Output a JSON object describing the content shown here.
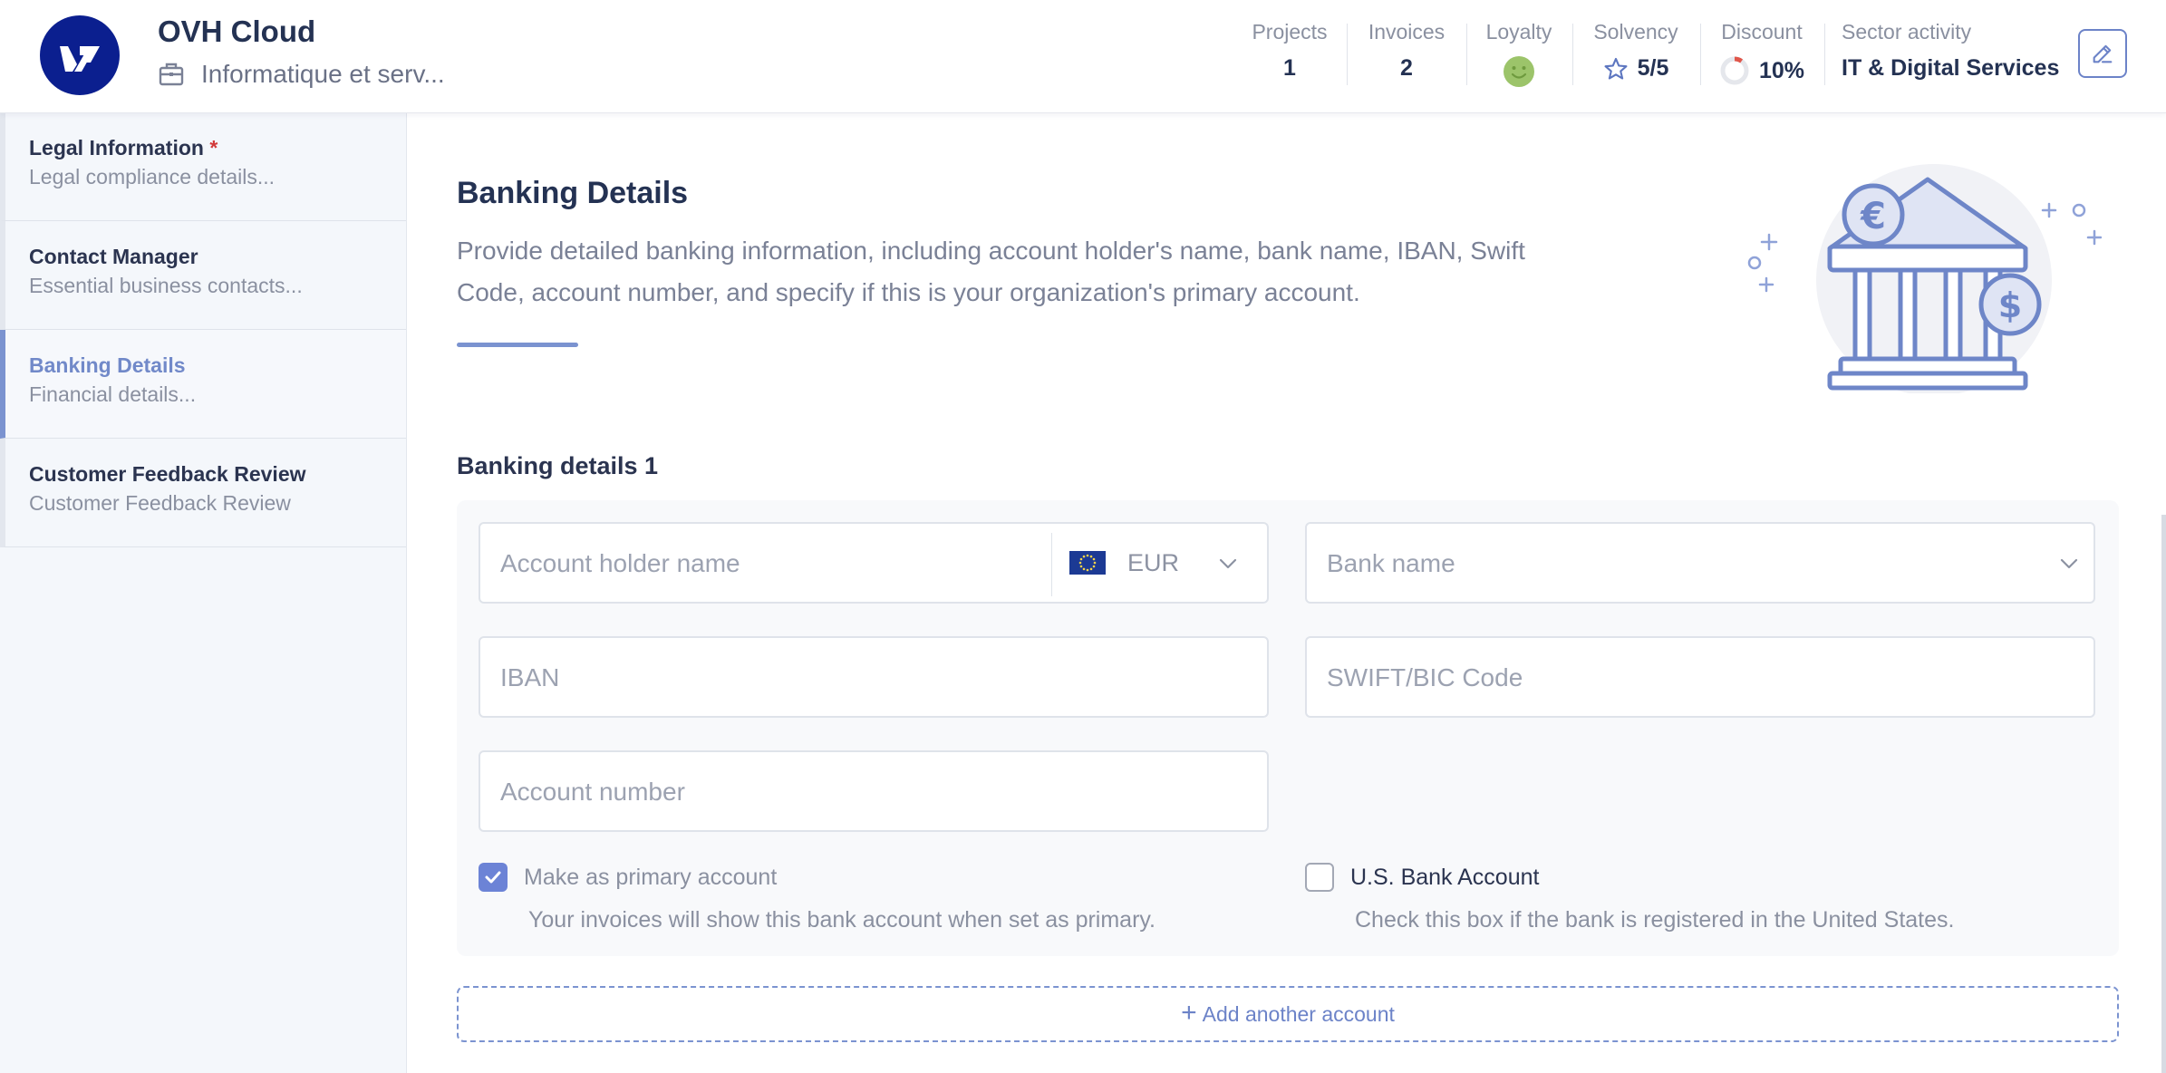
{
  "header": {
    "company_name": "OVH Cloud",
    "company_sector_short": "Informatique et serv...",
    "stats": {
      "projects": {
        "label": "Projects",
        "value": "1"
      },
      "invoices": {
        "label": "Invoices",
        "value": "2"
      },
      "loyalty": {
        "label": "Loyalty"
      },
      "solvency": {
        "label": "Solvency",
        "value": "5/5"
      },
      "discount": {
        "label": "Discount",
        "value": "10%"
      },
      "sector": {
        "label": "Sector activity",
        "value": "IT & Digital Services"
      }
    }
  },
  "sidebar": {
    "items": [
      {
        "title": "Legal Information",
        "required_mark": "*",
        "subtitle": "Legal compliance details..."
      },
      {
        "title": "Contact Manager",
        "subtitle": "Essential business contacts..."
      },
      {
        "title": "Banking Details",
        "subtitle": "Financial details..."
      },
      {
        "title": "Customer Feedback Review",
        "subtitle": "Customer Feedback Review"
      }
    ]
  },
  "main": {
    "title": "Banking Details",
    "description": "Provide detailed banking information, including account holder's name, bank name, IBAN, Swift Code, account number, and specify if this is your organization's primary account.",
    "section_title": "Banking details 1",
    "form": {
      "account_holder_placeholder": "Account holder name",
      "currency": "EUR",
      "bank_name_placeholder": "Bank name",
      "iban_placeholder": "IBAN",
      "swift_placeholder": "SWIFT/BIC Code",
      "account_number_placeholder": "Account number",
      "primary_label": "Make as primary account",
      "primary_help": "Your invoices will show this bank account when set as primary.",
      "primary_checked": true,
      "us_label": "U.S. Bank Account",
      "us_help": "Check this box if the bank is registered in the United States.",
      "us_checked": false
    },
    "add_button": "Add another account"
  },
  "colors": {
    "accent": "#7b93d0",
    "brand_logo": "#0b1f8f",
    "heading": "#243253",
    "loyalty_face": "#9cc46a"
  },
  "icons": [
    "ovh-logo-icon",
    "briefcase-icon",
    "smiley-icon",
    "star-icon",
    "discount-ring-icon",
    "edit-pencil-icon",
    "eu-flag-icon",
    "chevron-down-icon",
    "checkmark-icon",
    "plus-icon",
    "bank-illustration"
  ]
}
